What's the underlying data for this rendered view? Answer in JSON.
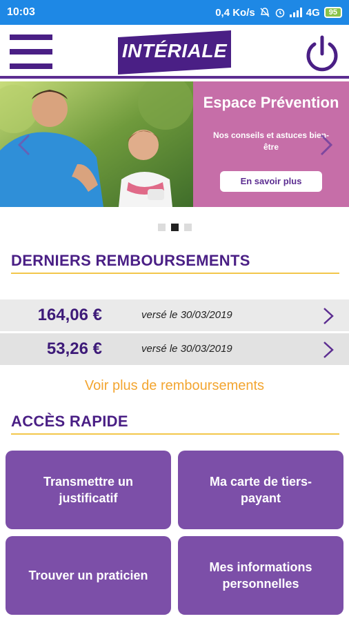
{
  "status": {
    "time": "10:03",
    "net_speed": "0,4 Ko/s",
    "network": "4G",
    "battery": "95"
  },
  "header": {
    "logo_text": "INTÉRIALE",
    "menu_icon": "hamburger-icon",
    "power_icon": "power-icon"
  },
  "banner": {
    "title": "Espace Prévention",
    "subtitle": "Nos conseils et astuces bien-être",
    "button": "En savoir plus"
  },
  "carousel": {
    "count": 3,
    "active_index": 1
  },
  "reimbursements": {
    "section_title": "DERNIERS REMBOURSEMENTS",
    "rows": [
      {
        "amount": "164,06 €",
        "date": "versé le 30/03/2019"
      },
      {
        "amount": "53,26 €",
        "date": "versé le 30/03/2019"
      }
    ],
    "more_link": "Voir plus de remboursements"
  },
  "quick_access": {
    "section_title": "ACCÈS RAPIDE",
    "tiles": [
      {
        "label": "Transmettre un justificatif"
      },
      {
        "label": "Ma carte de tiers-payant"
      },
      {
        "label": "Trouver un praticien"
      },
      {
        "label": "Mes informations personnelles"
      }
    ]
  },
  "colors": {
    "brand_purple": "#4a1f85",
    "tile_purple": "#7c4fa8",
    "banner_pink": "#c66ea8",
    "accent_yellow": "#f3c64a",
    "link_orange": "#f3a530",
    "status_blue": "#1e88e5"
  }
}
